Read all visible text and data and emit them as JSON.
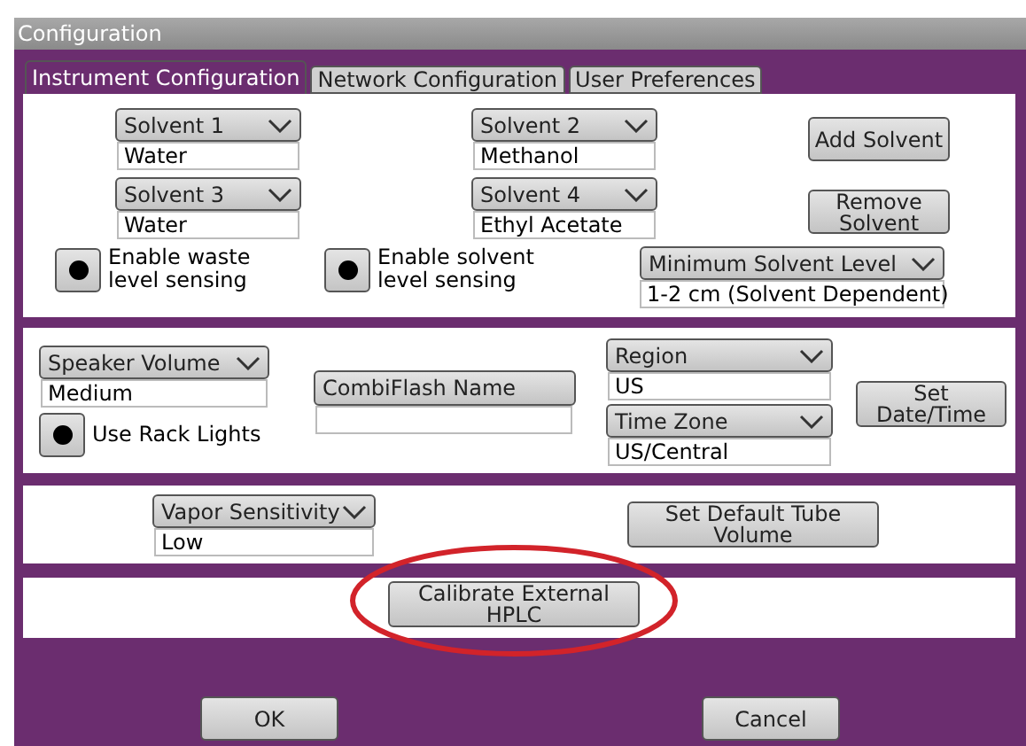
{
  "window": {
    "title": "Configuration"
  },
  "tabs": [
    {
      "label": "Instrument Configuration",
      "selected": true
    },
    {
      "label": "Network Configuration",
      "selected": false
    },
    {
      "label": "User Preferences",
      "selected": false
    }
  ],
  "solvents": [
    {
      "label": "Solvent 1",
      "value": "Water"
    },
    {
      "label": "Solvent 2",
      "value": "Methanol"
    },
    {
      "label": "Solvent 3",
      "value": "Water"
    },
    {
      "label": "Solvent 4",
      "value": "Ethyl Acetate"
    }
  ],
  "solvent_buttons": [
    "Add Solvent",
    "Remove Solvent"
  ],
  "sensing": [
    {
      "label": "Enable waste level sensing",
      "checked": true
    },
    {
      "label": "Enable solvent level sensing",
      "checked": true
    }
  ],
  "minimum_solvent_level": {
    "label": "Minimum Solvent Level",
    "value": "1-2 cm (Solvent Dependent)"
  },
  "speaker_volume": {
    "label": "Speaker Volume",
    "value": "Medium"
  },
  "rack_lights": {
    "label": "Use Rack Lights",
    "checked": true
  },
  "combiflash_name": {
    "label": "CombiFlash Name"
  },
  "region": {
    "label": "Region",
    "value": "US"
  },
  "time_zone": {
    "label": "Time Zone",
    "value": "US/Central"
  },
  "set_date_time": "Set Date/Time",
  "vapor_sensitivity": {
    "label": "Vapor Sensitivity",
    "value": "Low"
  },
  "default_tube_volume": "Set Default Tube Volume",
  "calibrate": {
    "label": "Calibrate External HPLC",
    "highlighted": true
  },
  "footer_buttons": [
    "OK",
    "Cancel"
  ]
}
